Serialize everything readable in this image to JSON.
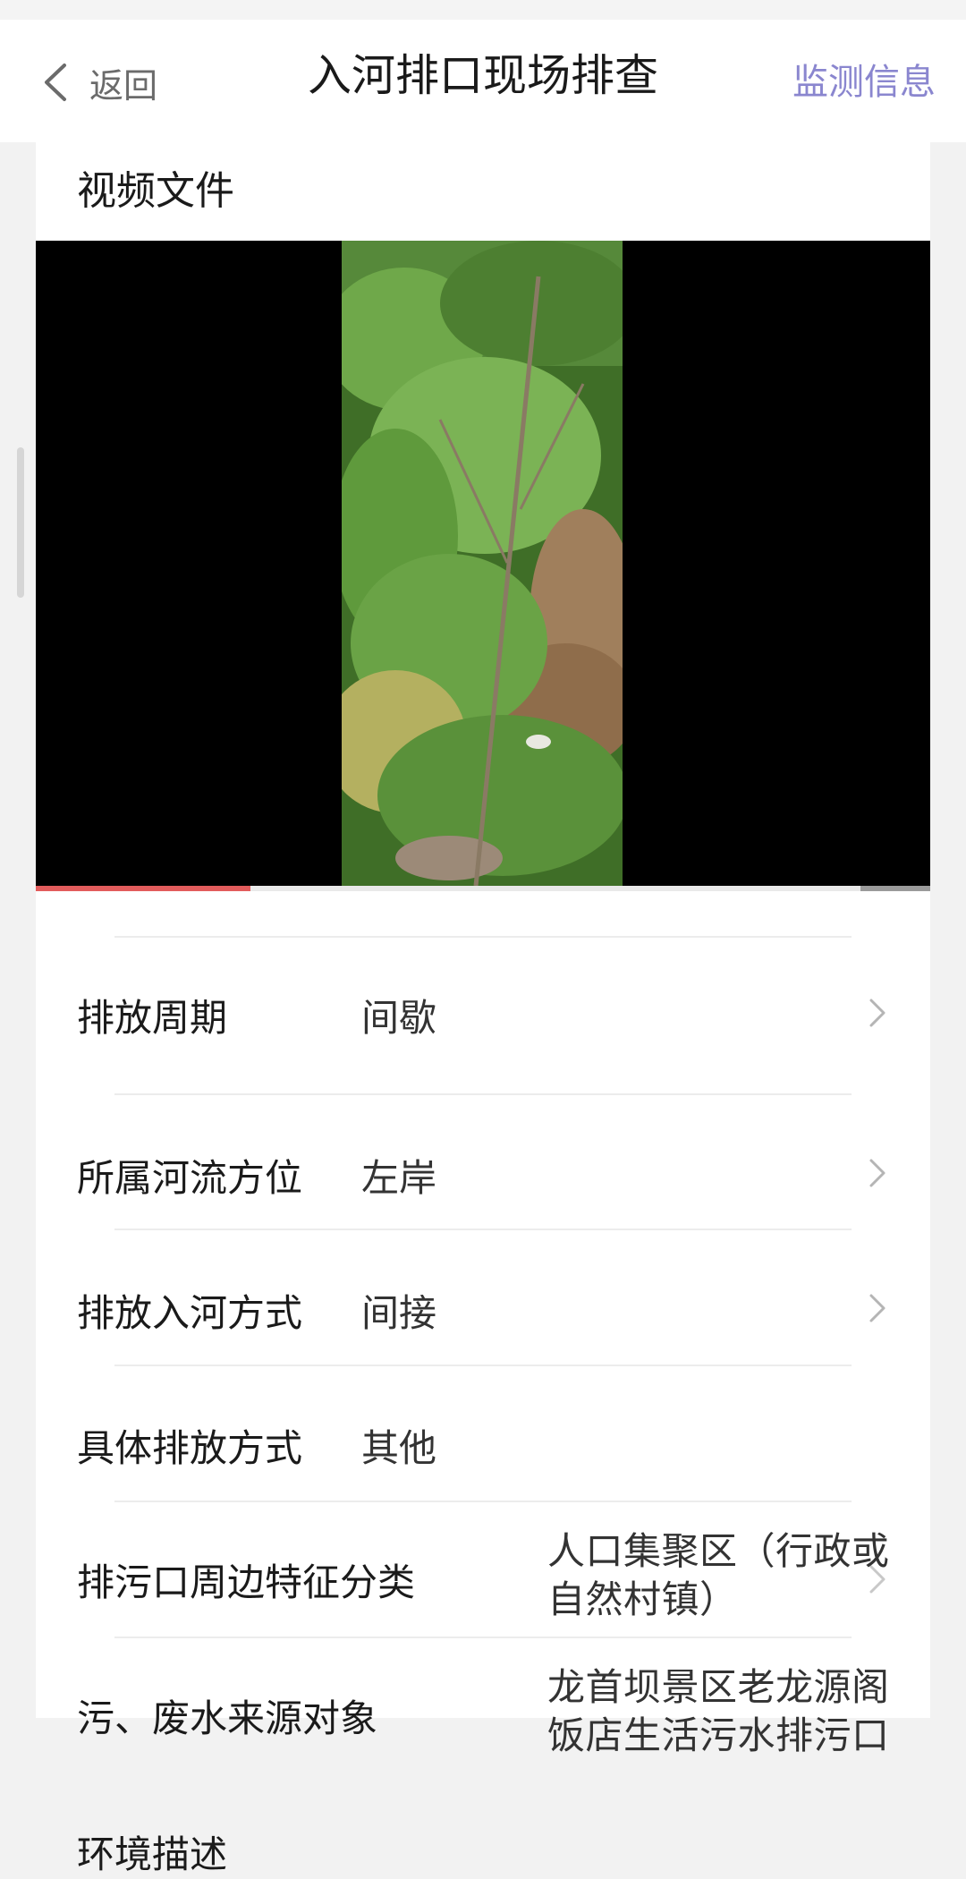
{
  "nav": {
    "back_label": "返回",
    "title": "入河排口现场排查",
    "right_label": "监测信息"
  },
  "video_section": {
    "title": "视频文件",
    "progress_fraction": 0.24
  },
  "fields": {
    "discharge_period": {
      "label": "排放周期",
      "value": "间歇"
    },
    "river_position": {
      "label": "所属河流方位",
      "value": "左岸"
    },
    "discharge_method": {
      "label": "排放入河方式",
      "value": "间接"
    },
    "specific_method": {
      "label": "具体排放方式",
      "value": "其他"
    },
    "surrounding_class": {
      "label": "排污口周边特征分类",
      "value": "人口集聚区（行政或自然村镇）"
    },
    "source_object": {
      "label": "污、废水来源对象",
      "value": "龙首坝景区老龙源阁饭店生活污水排污口"
    },
    "environment": {
      "label": "环境描述"
    }
  },
  "icons": {
    "back": "back-chevron-icon",
    "row_arrow": "chevron-right-icon"
  },
  "colors": {
    "accent": "#8a86cf",
    "progress": "#e25c5c"
  }
}
